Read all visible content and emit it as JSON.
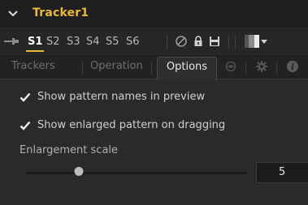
{
  "header": {
    "title": "Tracker1",
    "chevron_icon": "chevron-down-icon"
  },
  "toolbar": {
    "pin_icon": "pin-icon",
    "slots": [
      "S1",
      "S2",
      "S3",
      "S4",
      "S5",
      "S6"
    ],
    "active_slot": "S1",
    "tools": [
      "disable-icon",
      "lock-icon",
      "save-icon",
      "color-swatch-icon",
      "dropdown-caret-icon"
    ]
  },
  "tabs": {
    "items": [
      "Trackers",
      "Operation",
      "Options"
    ],
    "active": "Options",
    "extra_icons": [
      "modifier-icon",
      "settings-icon",
      "info-icon"
    ]
  },
  "options": {
    "show_pattern_names": {
      "label": "Show pattern names in preview",
      "checked": true
    },
    "show_enlarged_pattern": {
      "label": "Show enlarged pattern on dragging",
      "checked": true
    },
    "enlargement_scale": {
      "label": "Enlargement scale",
      "value": "5",
      "slider_fraction": 0.24
    }
  },
  "colors": {
    "accent": "#e8b93a",
    "panel_bg": "#2a2a2a",
    "text": "#cfcfcf"
  }
}
